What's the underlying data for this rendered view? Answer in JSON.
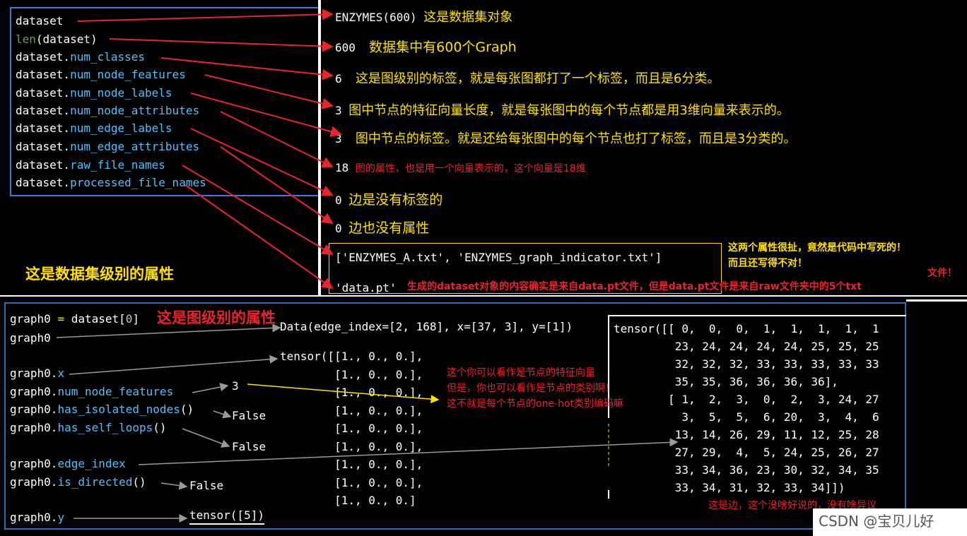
{
  "top": {
    "code_lines": [
      {
        "obj": "dataset",
        "attr": ""
      },
      {
        "fn": "len",
        "rest": "(dataset)"
      },
      {
        "obj": "dataset.",
        "attr": "num_classes"
      },
      {
        "obj": "dataset.",
        "attr": "num_node_features"
      },
      {
        "obj": "dataset.",
        "attr": "num_node_labels"
      },
      {
        "obj": "dataset.",
        "attr": "num_node_attributes"
      },
      {
        "obj": "dataset.",
        "attr": "num_edge_labels"
      },
      {
        "obj": "dataset.",
        "attr": "num_edge_attributes"
      },
      {
        "obj": "dataset.",
        "attr": "raw_file_names"
      },
      {
        "obj": "dataset.",
        "attr": "processed_file_names"
      }
    ],
    "section_label": "这是数据集级别的属性",
    "outputs": [
      {
        "value": "ENZYMES(600)",
        "note": "这是数据集对象"
      },
      {
        "value": "600",
        "note": "数据集中有600个Graph"
      },
      {
        "value": "6",
        "note": "这是图级别的标签，就是每张图都打了一个标签，而且是6分类。"
      },
      {
        "value": "3",
        "note": "图中节点的特征向量长度，就是每张图中的每个节点都是用3维向量来表示的。"
      },
      {
        "value": "3",
        "note": "图中节点的标签。就是还给每张图中的每个节点也打了标签，而且是3分类的。"
      },
      {
        "value": "18",
        "note": "图的属性，也是用一个向量表示的，这个向量是18维"
      },
      {
        "value": "0",
        "note": "边是没有标签的"
      },
      {
        "value": "0",
        "note": "边也没有属性"
      }
    ],
    "raw_files": "['ENZYMES_A.txt', 'ENZYMES_graph_indicator.txt']",
    "processed_files": "'data.pt'",
    "yellow_note_1": "这两个属性很扯，竟然是代码中写死的！",
    "yellow_note_2": "而且还写得不对！",
    "red_note_1": "文件！",
    "red_note_2": "生成的dataset对象的内容确实是来自data.pt文件，但是data.pt文件是来自raw文件夹中的5个txt"
  },
  "bottom": {
    "assign": {
      "lhs": "graph0",
      "op": "=",
      "rhs": "dataset[",
      "idx": "0",
      "close": "]"
    },
    "section_label": "这是图级别的属性",
    "code_lines": [
      "graph0",
      "graph0.x",
      "graph0.num_node_features",
      "graph0.has_isolated_nodes()",
      "graph0.has_self_loops()",
      "graph0.edge_index",
      "graph0.is_directed()",
      "graph0.y"
    ],
    "graph_repr": "Data(edge_index=[2, 168], x=[37, 3], y=[1])",
    "x_rows": [
      "tensor([[1., 0., 0.],",
      "        [1., 0., 0.],",
      "        [1., 0., 0.],",
      "        [1., 0., 0.],",
      "        [1., 0., 0.],",
      "        [1., 0., 0.],",
      "        [1., 0., 0.],",
      "        [1., 0., 0.],",
      "        [1., 0., 0.]"
    ],
    "num_node_features": "3",
    "isolated": "False",
    "self_loops": "False",
    "directed": "False",
    "y_value": "tensor([5])",
    "x_notes": [
      "这个你可以看作是节点的特征向量",
      "但是，你也可以看作是节点的类别啊！",
      "这不就是每个节点的one-hot类别编码嘛"
    ],
    "edge_rows": [
      "tensor([[ 0,  0,  0,  1,  1,  1,  1,  1",
      "         23, 24, 24, 24, 24, 25, 25, 25",
      "         32, 32, 32, 33, 33, 33, 33, 33",
      "         35, 35, 36, 36, 36, 36],",
      "        [ 1,  2,  3,  0,  2,  3, 24, 27",
      "          3,  5,  5,  6, 20,  3,  4,  6",
      "         13, 14, 26, 29, 11, 12, 25, 28",
      "         27, 29,  4,  5, 24, 25, 26, 27",
      "         33, 34, 36, 23, 30, 32, 34, 35",
      "         33, 34, 31, 32, 33, 34]])"
    ],
    "edge_note": "这是边，这个没啥好说的，没有啥异议"
  },
  "watermark": "CSDN @宝贝儿好",
  "colors": {
    "attr": "#4fc1ff",
    "fn": "#6a9955",
    "yellow": "#ffe000",
    "red": "#e8262a",
    "box_blue": "#3a7bd5"
  }
}
